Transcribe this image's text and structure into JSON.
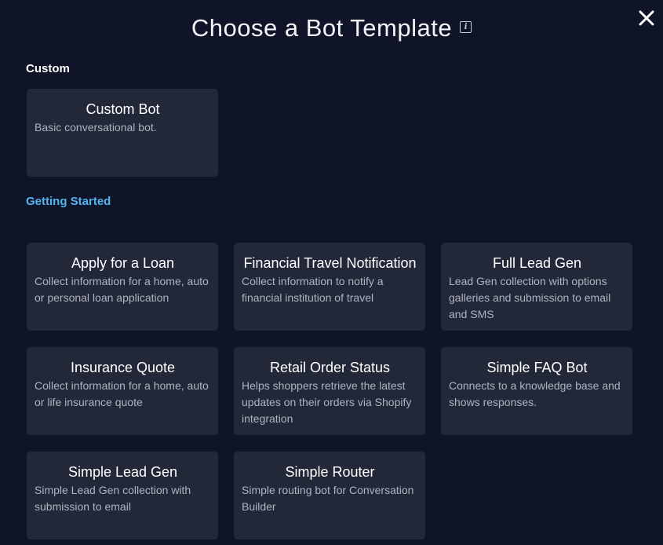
{
  "header": {
    "title": "Choose a Bot Template",
    "info_icon": "info-icon",
    "close_icon": "close-icon"
  },
  "sections": {
    "custom": "Custom",
    "getting_started": "Getting Started"
  },
  "colors": {
    "background": "#0f1429",
    "card": "#232839",
    "link": "#4fb6ef"
  },
  "cards": [
    {
      "title": "Custom Bot",
      "description": "Basic conversational bot."
    },
    {
      "title": "Apply for a Loan",
      "description": "Collect information for a home, auto or personal loan application"
    },
    {
      "title": "Financial Travel Notification",
      "description": "Collect information to notify a financial institution of travel"
    },
    {
      "title": "Full Lead Gen",
      "description": "Lead Gen collection with options galleries and submission to email and SMS"
    },
    {
      "title": "Insurance Quote",
      "description": "Collect information for a home, auto or life insurance quote"
    },
    {
      "title": "Retail Order Status",
      "description": "Helps shoppers retrieve the latest updates on their orders via Shopify integration"
    },
    {
      "title": "Simple FAQ Bot",
      "description": "Connects to a knowledge base and shows responses."
    },
    {
      "title": "Simple Lead Gen",
      "description": "Simple Lead Gen collection with submission to email"
    },
    {
      "title": "Simple Router",
      "description": "Simple routing bot for Conversation Builder"
    }
  ]
}
